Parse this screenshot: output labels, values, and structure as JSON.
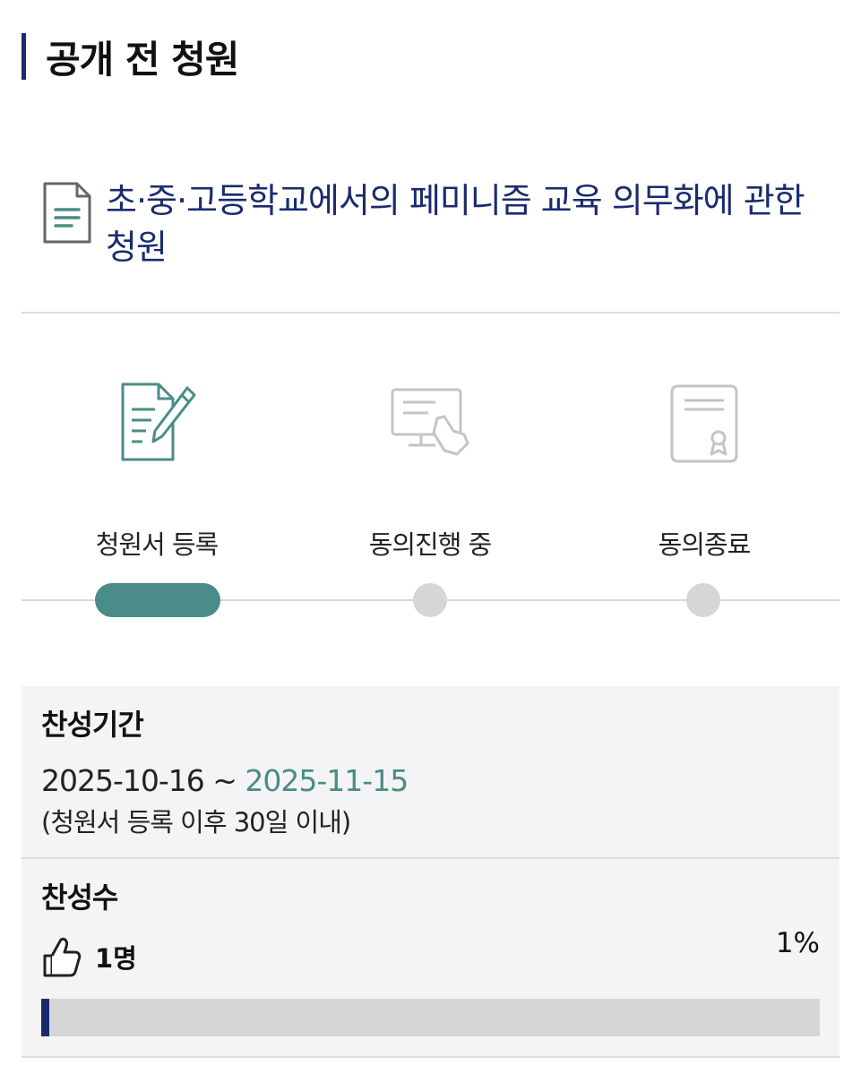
{
  "header": {
    "title": "공개 전 청원"
  },
  "petition": {
    "title": "초·중·고등학교에서의 페미니즘 교육 의무화에 관한 청원",
    "icon": "document-icon"
  },
  "steps": [
    {
      "label": "청원서 등록",
      "icon": "write-pen-icon",
      "state": "active"
    },
    {
      "label": "동의진행 중",
      "icon": "monitor-click-icon",
      "state": "inactive"
    },
    {
      "label": "동의종료",
      "icon": "certificate-icon",
      "state": "inactive"
    }
  ],
  "agree_period": {
    "heading": "찬성기간",
    "start": "2025-10-16",
    "separator": " ~ ",
    "end": "2025-11-15",
    "note": "(청원서 등록 이후 30일 이내)"
  },
  "agree_count": {
    "heading": "찬성수",
    "icon": "thumbs-up-icon",
    "value": "1명",
    "percent_label": "1%",
    "progress": 0.01
  },
  "colors": {
    "navy": "#1a2b6d",
    "teal": "#4a8c87",
    "inactive": "#d6d6d6"
  }
}
